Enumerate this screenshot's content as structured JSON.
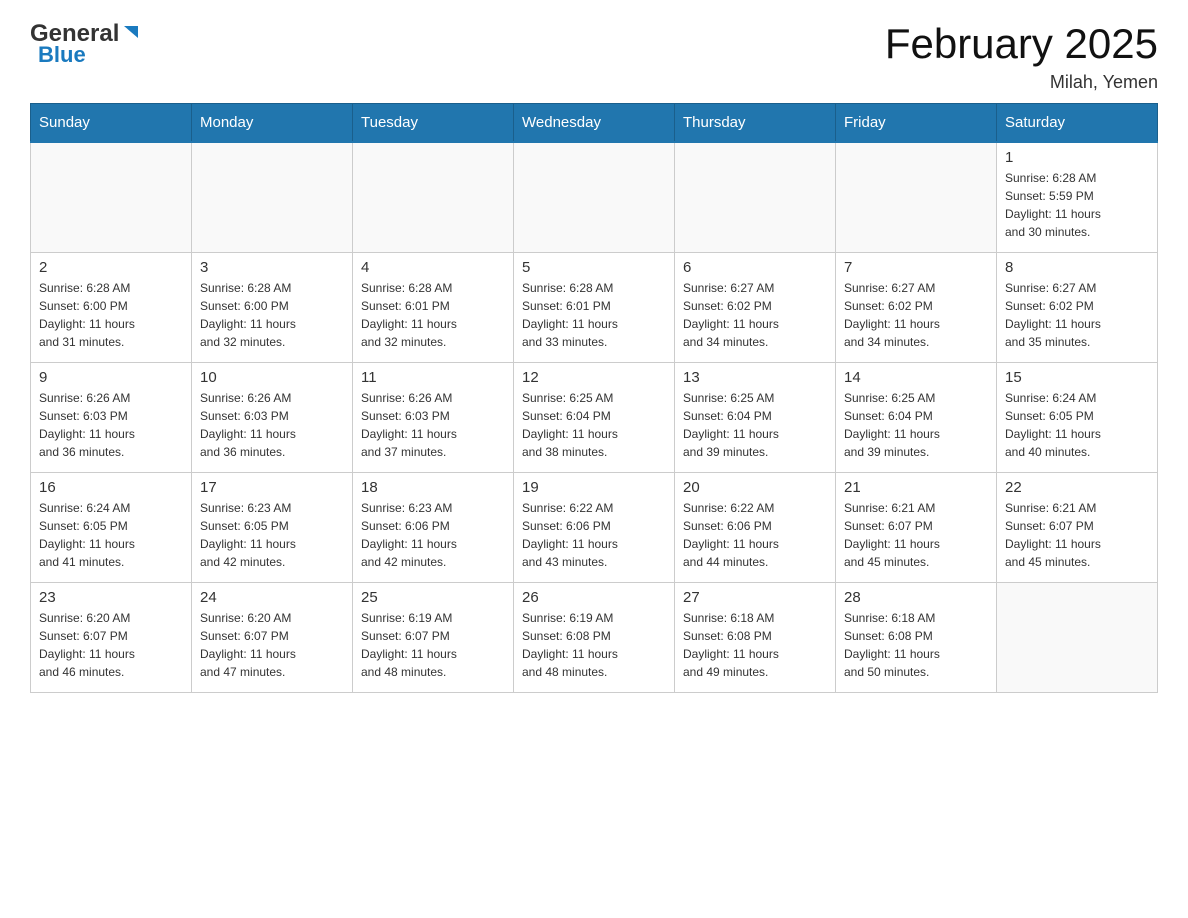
{
  "logo": {
    "general": "General",
    "blue": "Blue",
    "tagline": "GeneralBlue"
  },
  "title": "February 2025",
  "location": "Milah, Yemen",
  "weekdays": [
    "Sunday",
    "Monday",
    "Tuesday",
    "Wednesday",
    "Thursday",
    "Friday",
    "Saturday"
  ],
  "weeks": [
    [
      {
        "day": "",
        "info": ""
      },
      {
        "day": "",
        "info": ""
      },
      {
        "day": "",
        "info": ""
      },
      {
        "day": "",
        "info": ""
      },
      {
        "day": "",
        "info": ""
      },
      {
        "day": "",
        "info": ""
      },
      {
        "day": "1",
        "info": "Sunrise: 6:28 AM\nSunset: 5:59 PM\nDaylight: 11 hours\nand 30 minutes."
      }
    ],
    [
      {
        "day": "2",
        "info": "Sunrise: 6:28 AM\nSunset: 6:00 PM\nDaylight: 11 hours\nand 31 minutes."
      },
      {
        "day": "3",
        "info": "Sunrise: 6:28 AM\nSunset: 6:00 PM\nDaylight: 11 hours\nand 32 minutes."
      },
      {
        "day": "4",
        "info": "Sunrise: 6:28 AM\nSunset: 6:01 PM\nDaylight: 11 hours\nand 32 minutes."
      },
      {
        "day": "5",
        "info": "Sunrise: 6:28 AM\nSunset: 6:01 PM\nDaylight: 11 hours\nand 33 minutes."
      },
      {
        "day": "6",
        "info": "Sunrise: 6:27 AM\nSunset: 6:02 PM\nDaylight: 11 hours\nand 34 minutes."
      },
      {
        "day": "7",
        "info": "Sunrise: 6:27 AM\nSunset: 6:02 PM\nDaylight: 11 hours\nand 34 minutes."
      },
      {
        "day": "8",
        "info": "Sunrise: 6:27 AM\nSunset: 6:02 PM\nDaylight: 11 hours\nand 35 minutes."
      }
    ],
    [
      {
        "day": "9",
        "info": "Sunrise: 6:26 AM\nSunset: 6:03 PM\nDaylight: 11 hours\nand 36 minutes."
      },
      {
        "day": "10",
        "info": "Sunrise: 6:26 AM\nSunset: 6:03 PM\nDaylight: 11 hours\nand 36 minutes."
      },
      {
        "day": "11",
        "info": "Sunrise: 6:26 AM\nSunset: 6:03 PM\nDaylight: 11 hours\nand 37 minutes."
      },
      {
        "day": "12",
        "info": "Sunrise: 6:25 AM\nSunset: 6:04 PM\nDaylight: 11 hours\nand 38 minutes."
      },
      {
        "day": "13",
        "info": "Sunrise: 6:25 AM\nSunset: 6:04 PM\nDaylight: 11 hours\nand 39 minutes."
      },
      {
        "day": "14",
        "info": "Sunrise: 6:25 AM\nSunset: 6:04 PM\nDaylight: 11 hours\nand 39 minutes."
      },
      {
        "day": "15",
        "info": "Sunrise: 6:24 AM\nSunset: 6:05 PM\nDaylight: 11 hours\nand 40 minutes."
      }
    ],
    [
      {
        "day": "16",
        "info": "Sunrise: 6:24 AM\nSunset: 6:05 PM\nDaylight: 11 hours\nand 41 minutes."
      },
      {
        "day": "17",
        "info": "Sunrise: 6:23 AM\nSunset: 6:05 PM\nDaylight: 11 hours\nand 42 minutes."
      },
      {
        "day": "18",
        "info": "Sunrise: 6:23 AM\nSunset: 6:06 PM\nDaylight: 11 hours\nand 42 minutes."
      },
      {
        "day": "19",
        "info": "Sunrise: 6:22 AM\nSunset: 6:06 PM\nDaylight: 11 hours\nand 43 minutes."
      },
      {
        "day": "20",
        "info": "Sunrise: 6:22 AM\nSunset: 6:06 PM\nDaylight: 11 hours\nand 44 minutes."
      },
      {
        "day": "21",
        "info": "Sunrise: 6:21 AM\nSunset: 6:07 PM\nDaylight: 11 hours\nand 45 minutes."
      },
      {
        "day": "22",
        "info": "Sunrise: 6:21 AM\nSunset: 6:07 PM\nDaylight: 11 hours\nand 45 minutes."
      }
    ],
    [
      {
        "day": "23",
        "info": "Sunrise: 6:20 AM\nSunset: 6:07 PM\nDaylight: 11 hours\nand 46 minutes."
      },
      {
        "day": "24",
        "info": "Sunrise: 6:20 AM\nSunset: 6:07 PM\nDaylight: 11 hours\nand 47 minutes."
      },
      {
        "day": "25",
        "info": "Sunrise: 6:19 AM\nSunset: 6:07 PM\nDaylight: 11 hours\nand 48 minutes."
      },
      {
        "day": "26",
        "info": "Sunrise: 6:19 AM\nSunset: 6:08 PM\nDaylight: 11 hours\nand 48 minutes."
      },
      {
        "day": "27",
        "info": "Sunrise: 6:18 AM\nSunset: 6:08 PM\nDaylight: 11 hours\nand 49 minutes."
      },
      {
        "day": "28",
        "info": "Sunrise: 6:18 AM\nSunset: 6:08 PM\nDaylight: 11 hours\nand 50 minutes."
      },
      {
        "day": "",
        "info": ""
      }
    ]
  ]
}
